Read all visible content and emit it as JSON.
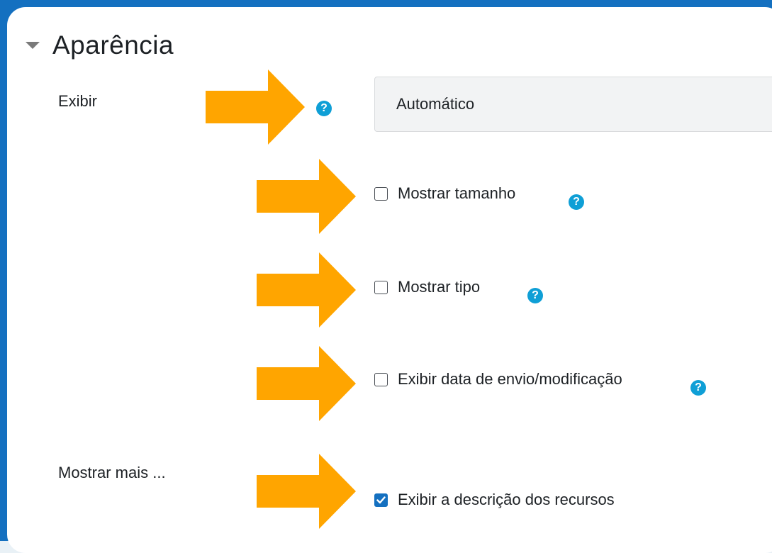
{
  "section": {
    "title": "Aparência",
    "caret_icon": "caret-down-icon"
  },
  "exibir": {
    "label": "Exibir",
    "select_value": "Automático"
  },
  "options": [
    {
      "label": "Mostrar tamanho",
      "checked": false
    },
    {
      "label": "Mostrar tipo",
      "checked": false
    },
    {
      "label": "Exibir data de envio/modificação",
      "checked": false
    }
  ],
  "mostrar_mais": {
    "label": "Mostrar mais ...",
    "option_label": "Exibir a descrição dos recursos",
    "checked": true
  },
  "help_icon_glyph": "?",
  "colors": {
    "accent": "#1470c0",
    "arrow": "#ffa500",
    "help": "#0f9fd6"
  }
}
